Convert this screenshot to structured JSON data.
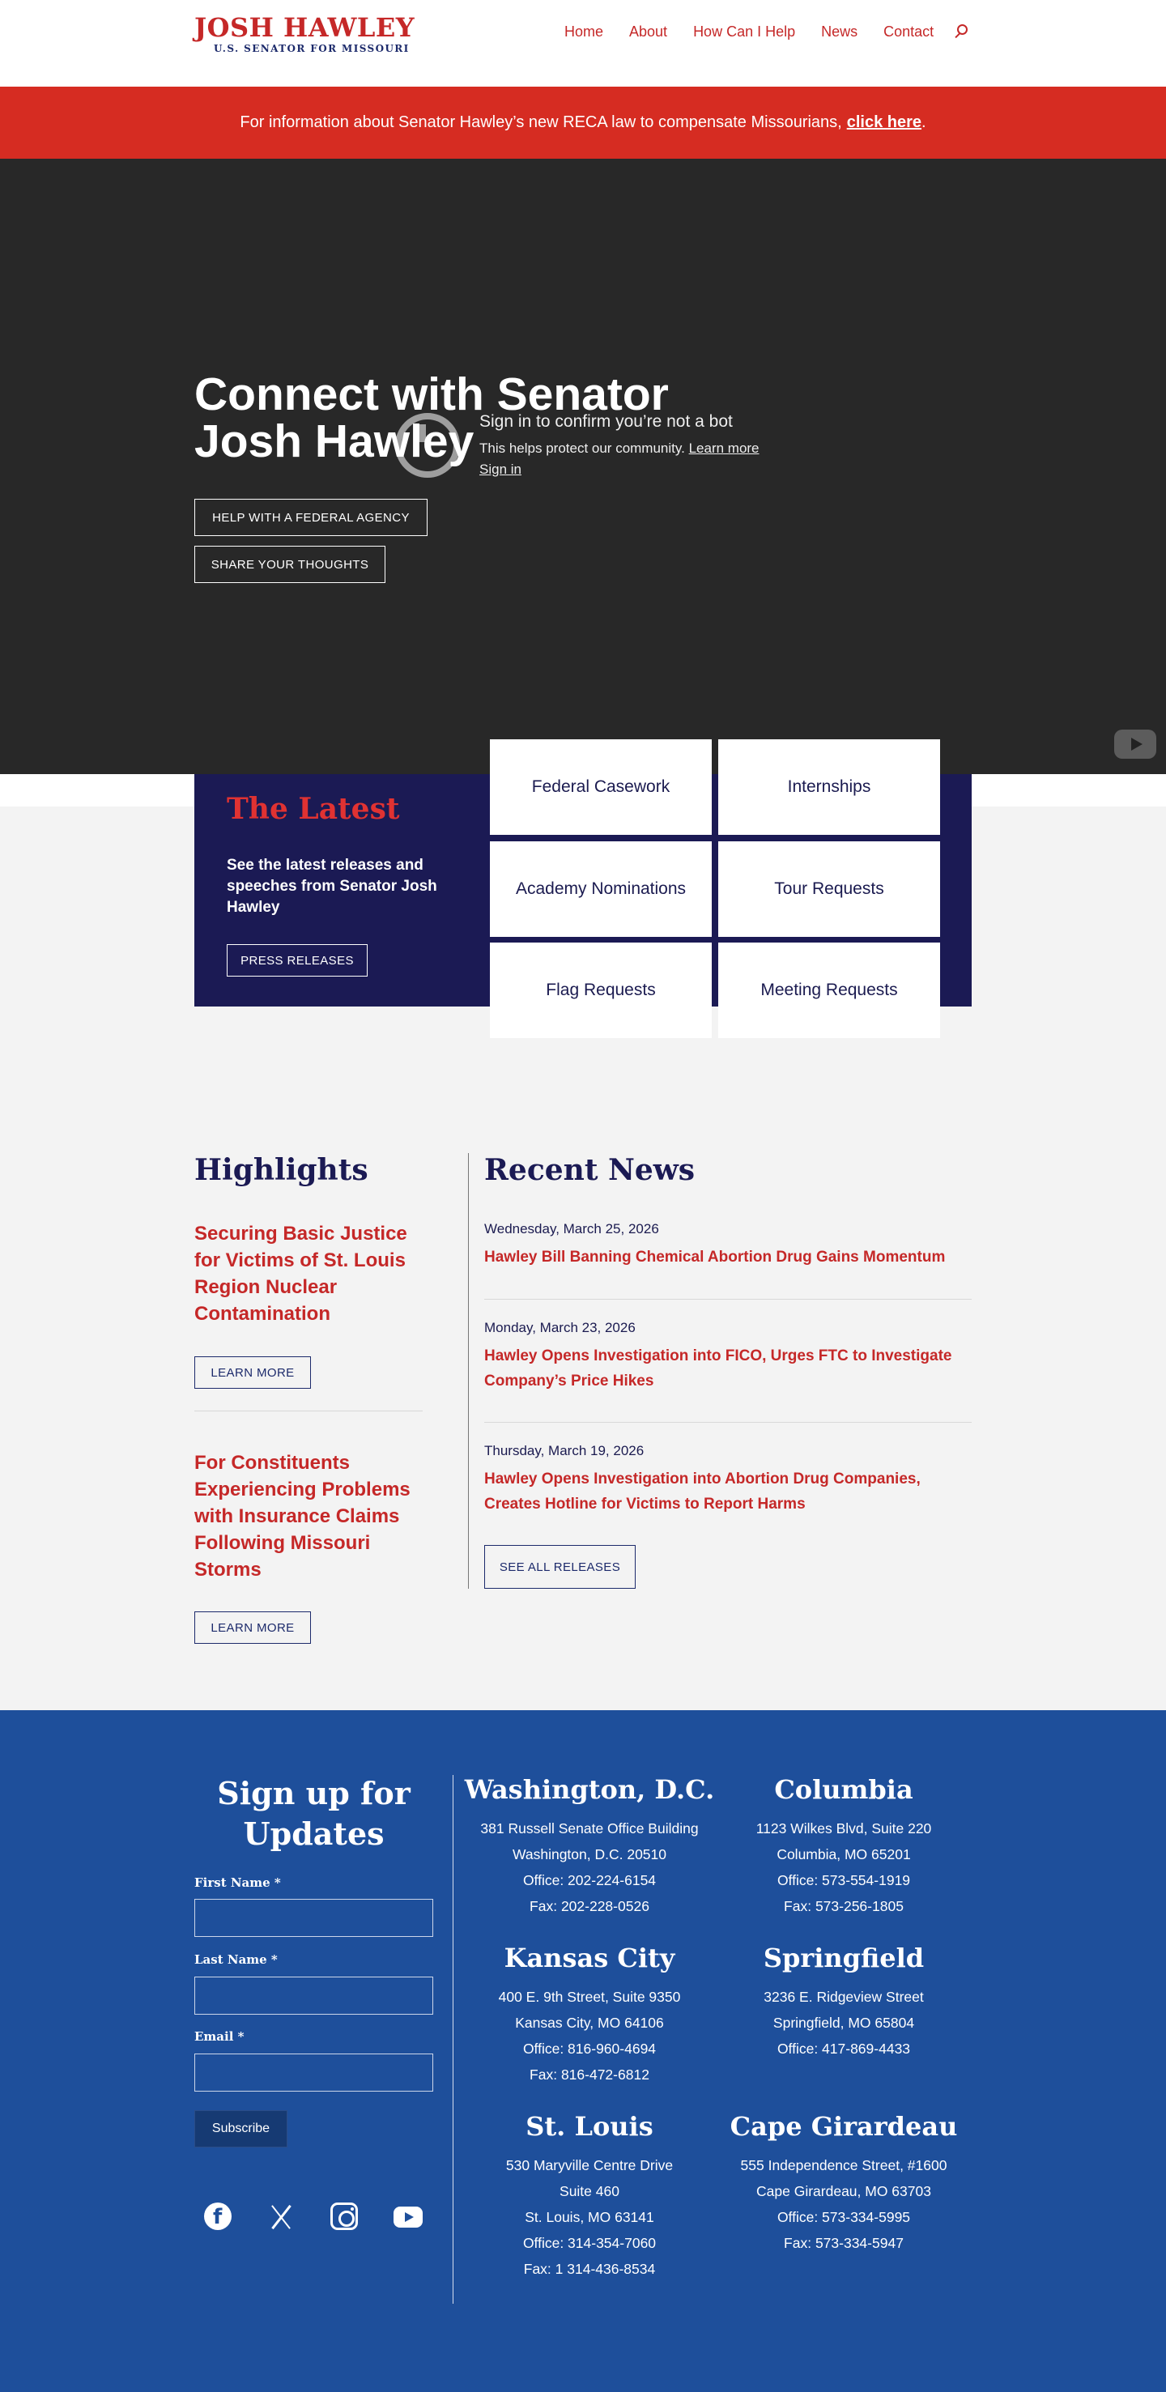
{
  "header": {
    "logo_name": "JOSH HAWLEY",
    "logo_subtitle": "U.S. SENATOR FOR MISSOURI",
    "nav": [
      "Home",
      "About",
      "How Can I Help",
      "News",
      "Contact"
    ]
  },
  "banner": {
    "text": "For information about Senator Hawley’s new RECA law to compensate Missourians,",
    "link": "click here",
    "end": "."
  },
  "hero": {
    "title": "Connect with Senator Josh Hawley",
    "buttons": [
      "HELP WITH A FEDERAL AGENCY",
      "SHARE YOUR THOUGHTS"
    ],
    "video_overlay": {
      "title": "Sign in to confirm you’re not a bot",
      "text": "This helps protect our community.",
      "learn_more": "Learn more",
      "sign_in": "Sign in"
    }
  },
  "latest": {
    "title": "The Latest",
    "description": "See the latest releases and speeches from Senator Josh Hawley",
    "button": "PRESS RELEASES",
    "tiles": [
      "Federal Casework",
      "Internships",
      "Academy Nominations",
      "Tour Requests",
      "Flag Requests",
      "Meeting Requests"
    ]
  },
  "highlights": {
    "title": "Highlights",
    "items": [
      {
        "title": "Securing Basic Justice for Victims of St. Louis Region Nuclear Contamination",
        "button": "LEARN MORE"
      },
      {
        "title": "For Constituents Experiencing Problems with Insurance Claims Following Missouri Storms",
        "button": "LEARN MORE"
      }
    ]
  },
  "news": {
    "title": "Recent News",
    "items": [
      {
        "date": "Wednesday, March 25, 2026",
        "headline": "Hawley Bill Banning Chemical Abortion Drug Gains Momentum"
      },
      {
        "date": "Monday, March 23, 2026",
        "headline": "Hawley Opens Investigation into FICO, Urges FTC to Investigate Company’s Price Hikes"
      },
      {
        "date": "Thursday, March 19, 2026",
        "headline": "Hawley Opens Investigation into Abortion Drug Companies, Creates Hotline for Victims to Report Harms"
      }
    ],
    "button": "SEE ALL RELEASES"
  },
  "footer": {
    "signup_title": "Sign up for Updates",
    "first_name_label": "First Name *",
    "last_name_label": "Last Name *",
    "email_label": "Email *",
    "subscribe": "Subscribe",
    "offices": [
      {
        "name": "Washington, D.C.",
        "lines": [
          "381 Russell Senate Office Building",
          "Washington, D.C. 20510",
          "Office: 202-224-6154",
          "Fax: 202-228-0526"
        ]
      },
      {
        "name": "Columbia",
        "lines": [
          "1123 Wilkes Blvd, Suite 220",
          "Columbia, MO 65201",
          "Office: 573-554-1919",
          "Fax: 573-256-1805"
        ]
      },
      {
        "name": "Kansas City",
        "lines": [
          "400 E. 9th Street, Suite 9350",
          "Kansas City, MO 64106",
          "Office: 816-960-4694",
          "Fax: 816-472-6812"
        ]
      },
      {
        "name": "Springfield",
        "lines": [
          "3236 E. Ridgeview Street",
          "Springfield, MO 65804",
          "Office: 417-869-4433"
        ]
      },
      {
        "name": "St. Louis",
        "lines": [
          "530 Maryville Centre Drive",
          "Suite 460",
          "St. Louis, MO 63141",
          "Office: 314-354-7060",
          "Fax: 1 314-436-8534"
        ]
      },
      {
        "name": "Cape Girardeau",
        "lines": [
          "555 Independence Street, #1600",
          "Cape Girardeau, MO 63703",
          "Office: 573-334-5995",
          "Fax: 573-334-5947"
        ]
      }
    ]
  }
}
